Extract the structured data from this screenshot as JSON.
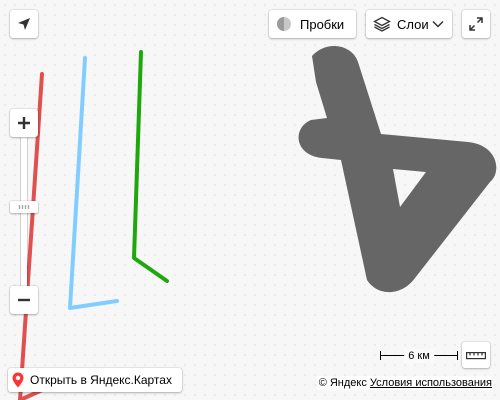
{
  "map": {
    "background": "#f7f7f7"
  },
  "overlay": {
    "route_red_color": "#e05050",
    "route_blue_color": "#81cdff",
    "route_green_color": "#1fa80c",
    "shape_gray_color": "#666666"
  },
  "controls": {
    "locate_icon": "navigation-arrow-icon",
    "traffic_label": "Пробки",
    "traffic_icon": "traffic-light-icon",
    "layers_label": "Слои",
    "layers_icon": "layers-icon",
    "fullscreen_icon": "expand-icon",
    "zoom_in_icon": "plus-icon",
    "zoom_out_icon": "minus-icon",
    "ruler_icon": "ruler-icon"
  },
  "scale": {
    "label": "6 км"
  },
  "footer": {
    "open_maps_label": "Открыть в Яндекс.Картах",
    "copyright_label": "© Яндекс",
    "terms_link": "Условия использования"
  }
}
